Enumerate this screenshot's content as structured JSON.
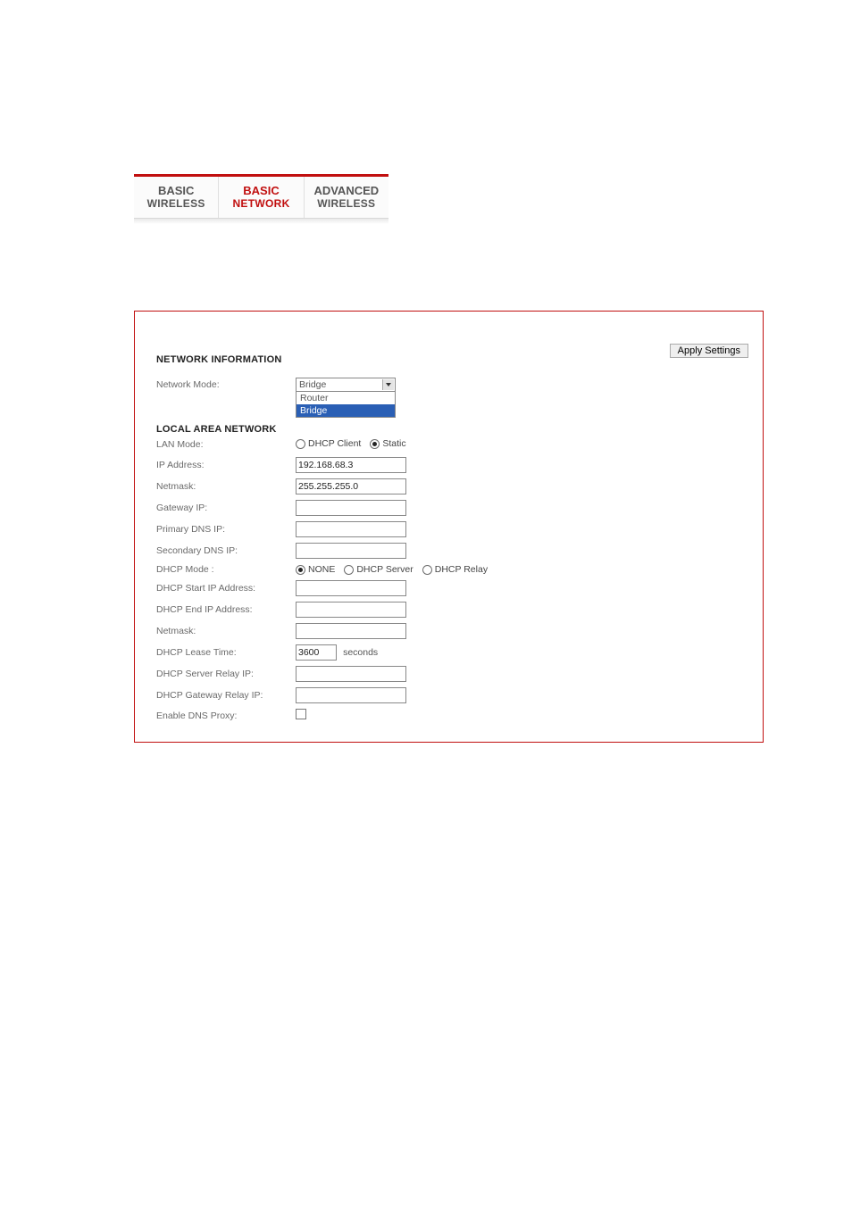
{
  "tabs": {
    "items": [
      {
        "line1": "BASIC",
        "line2": "WIRELESS",
        "active": false
      },
      {
        "line1": "BASIC",
        "line2": "NETWORK",
        "active": true
      },
      {
        "line1": "ADVANCED",
        "line2": "WIRELESS",
        "active": false
      }
    ]
  },
  "buttons": {
    "apply": "Apply Settings"
  },
  "sections": {
    "network_info": "NETWORK INFORMATION",
    "lan": "LOCAL AREA NETWORK"
  },
  "network": {
    "mode_label": "Network Mode:",
    "mode_value": "Bridge",
    "mode_options": [
      {
        "label": "Router",
        "selected": false
      },
      {
        "label": "Bridge",
        "selected": true
      }
    ]
  },
  "lan": {
    "mode_label": "LAN Mode:",
    "mode_options": [
      {
        "label": "DHCP Client",
        "checked": false
      },
      {
        "label": "Static",
        "checked": true
      }
    ],
    "ip_label": "IP Address:",
    "ip_value": "192.168.68.3",
    "netmask_label": "Netmask:",
    "netmask_value": "255.255.255.0",
    "gateway_label": "Gateway IP:",
    "gateway_value": "",
    "pdns_label": "Primary DNS IP:",
    "pdns_value": "",
    "sdns_label": "Secondary DNS IP:",
    "sdns_value": "",
    "dhcp_mode_label": "DHCP Mode :",
    "dhcp_mode_options": [
      {
        "label": "NONE",
        "checked": true
      },
      {
        "label": "DHCP Server",
        "checked": false
      },
      {
        "label": "DHCP Relay",
        "checked": false
      }
    ],
    "dhcp_start_label": "DHCP Start IP Address:",
    "dhcp_start_value": "",
    "dhcp_end_label": "DHCP End IP Address:",
    "dhcp_end_value": "",
    "dhcp_netmask_label": "Netmask:",
    "dhcp_netmask_value": "",
    "lease_label": "DHCP Lease Time:",
    "lease_value": "3600",
    "lease_unit": "seconds",
    "srv_relay_label": "DHCP Server Relay IP:",
    "srv_relay_value": "",
    "gw_relay_label": "DHCP Gateway Relay IP:",
    "gw_relay_value": "",
    "dns_proxy_label": "Enable DNS Proxy:",
    "dns_proxy_checked": false
  }
}
